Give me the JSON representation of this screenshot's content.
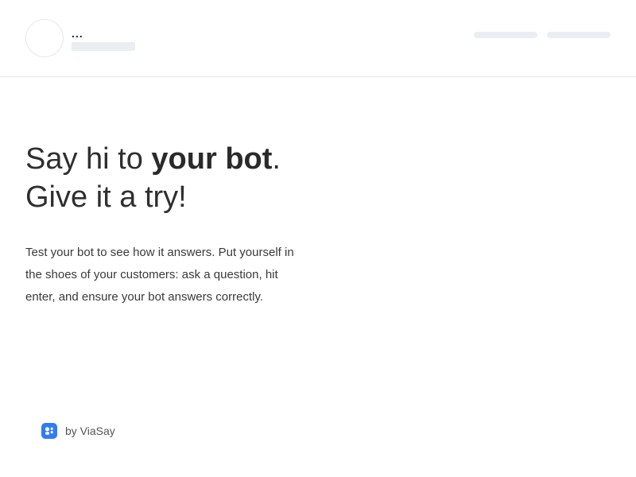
{
  "header": {
    "bot_name": "..."
  },
  "hero": {
    "headline_part1": "Say hi to ",
    "headline_bold": "your bot",
    "headline_part2": ".",
    "headline_line2": "Give it a try!",
    "description": "Test your bot to see how it answers. Put yourself in the shoes of your customers: ask a question, hit enter, and ensure your bot answers correctly."
  },
  "footer": {
    "branding_label": "by ViaSay",
    "logo_icon": "viasay-logo-icon",
    "brand_color": "#2f7cf6"
  }
}
